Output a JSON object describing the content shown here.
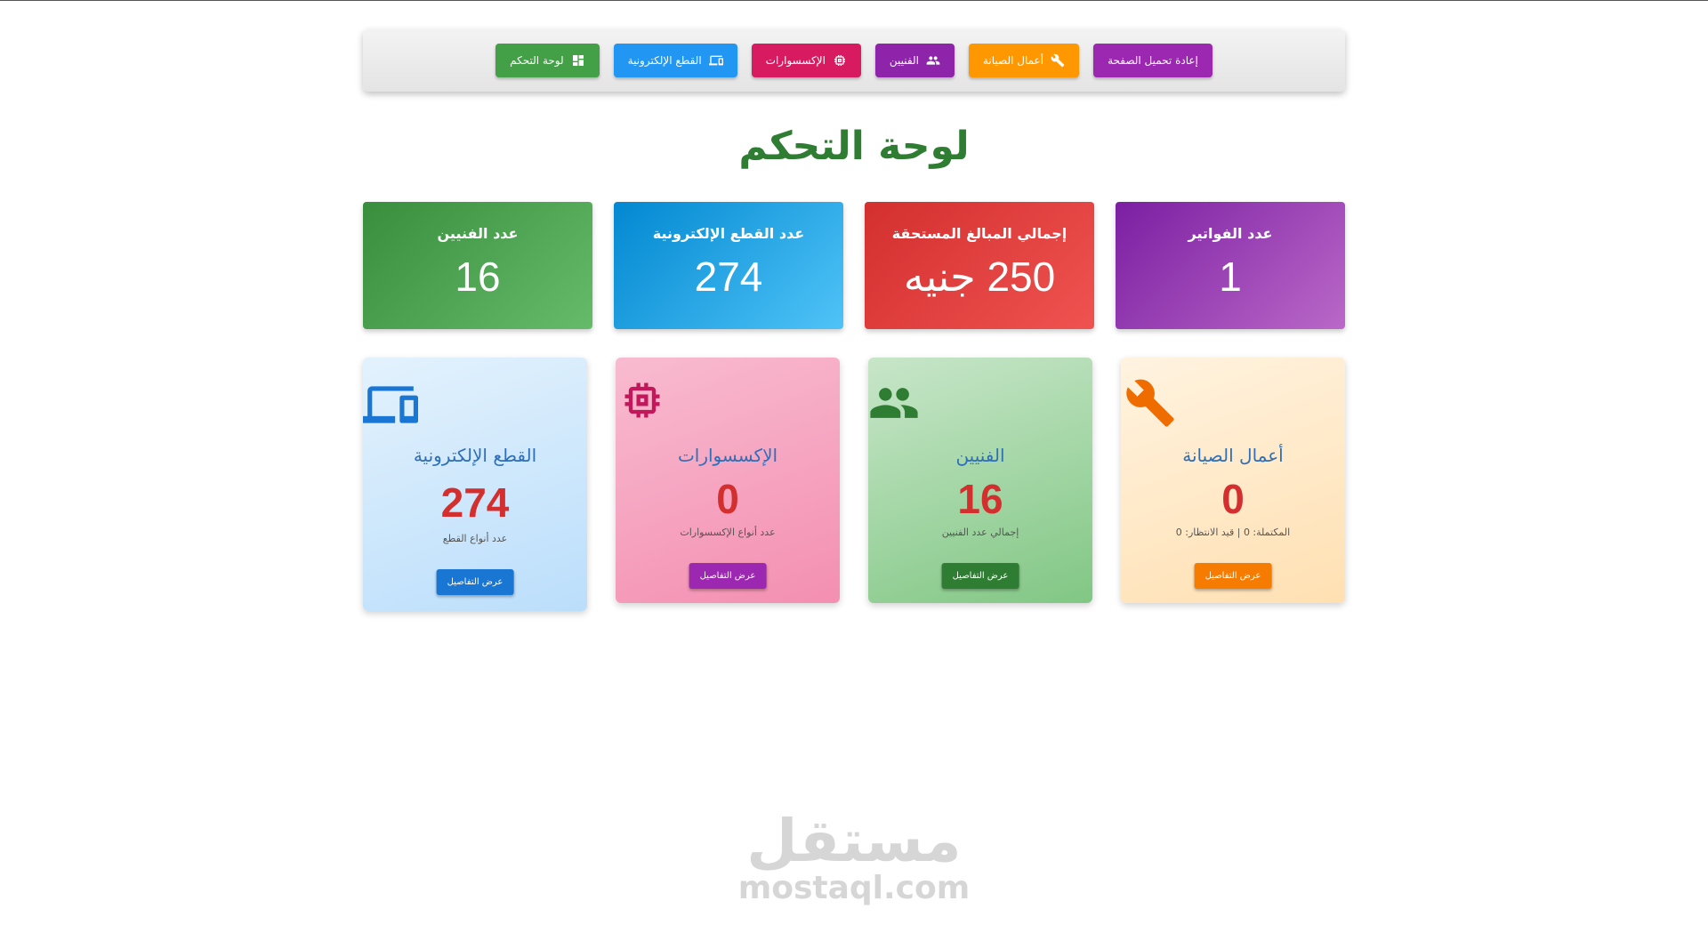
{
  "nav": {
    "reload": "إعادة تحميل الصفحة",
    "maintenance": "أعمال الصيانة",
    "technicians": "الفنيين",
    "accessories": "الإكسسوارات",
    "electronic_parts": "القطع الإلكترونية",
    "dashboard": "لوحة التحكم"
  },
  "page_title": "لوحة التحكم",
  "stats": [
    {
      "label": "عدد الفواتير",
      "value": "1"
    },
    {
      "label": "إجمالي المبالغ المستحقة",
      "value": "250 جنيه"
    },
    {
      "label": "عدد القطع الإلكترونية",
      "value": "274"
    },
    {
      "label": "عدد الفنيين",
      "value": "16"
    }
  ],
  "cards": [
    {
      "title": "أعمال الصيانة",
      "value": "0",
      "subtitle": "المكتملة: 0 | قيد الانتظار: 0",
      "button": "عرض التفاصيل",
      "icon": "wrench-icon"
    },
    {
      "title": "الفنيين",
      "value": "16",
      "subtitle": "إجمالي عدد الفنيين",
      "button": "عرض التفاصيل",
      "icon": "people-icon"
    },
    {
      "title": "الإكسسوارات",
      "value": "0",
      "subtitle": "عدد أنواع الإكسسوارات",
      "button": "عرض التفاصيل",
      "icon": "chip-icon"
    },
    {
      "title": "القطع الإلكترونية",
      "value": "274",
      "subtitle": "عدد أنواع القطع",
      "button": "عرض التفاصيل",
      "icon": "devices-icon"
    }
  ],
  "colors": {
    "title_green": "#2e7d32",
    "card_title_blue": "#2f6fb8",
    "card_value_red": "#d32f2f"
  },
  "watermark": {
    "arabic": "مستقل",
    "latin": "mostaql.com"
  }
}
